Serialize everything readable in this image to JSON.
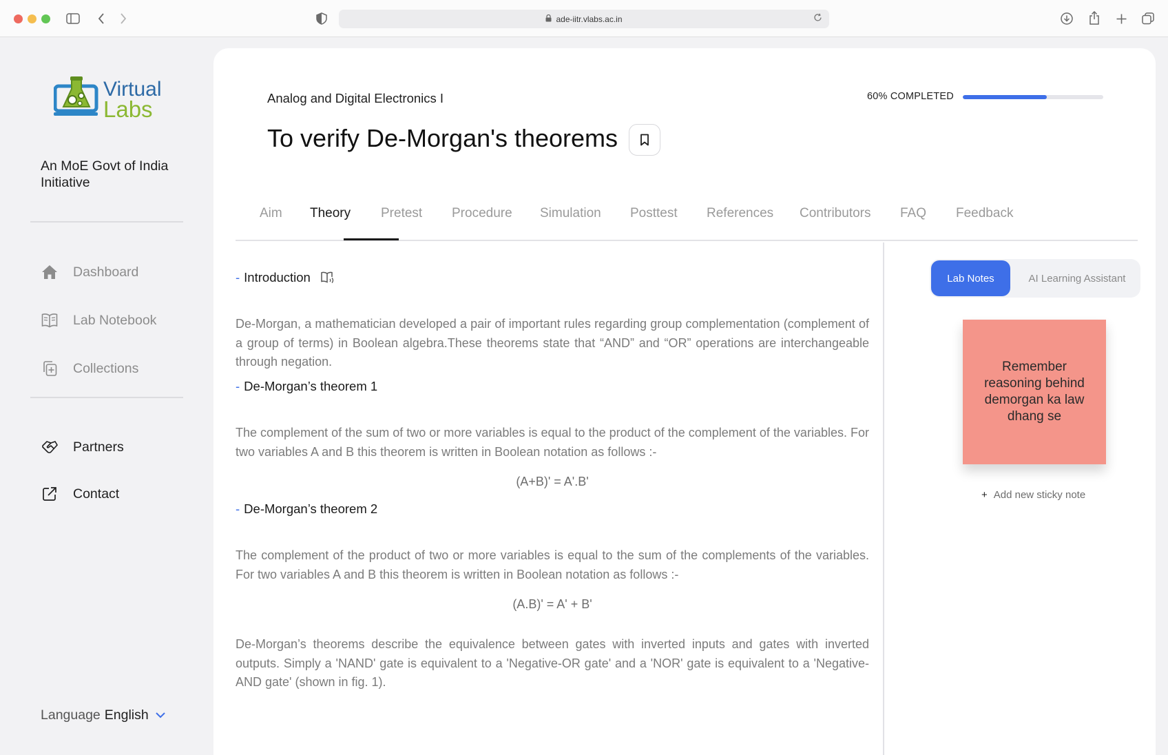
{
  "browser": {
    "url": "ade-iitr.vlabs.ac.in"
  },
  "sidebar": {
    "logo": {
      "line1": "Virtual",
      "line2": "Labs"
    },
    "tagline": "An MoE Govt of India Initiative",
    "nav": [
      {
        "label": "Dashboard",
        "icon": "home-icon"
      },
      {
        "label": "Lab Notebook",
        "icon": "notebook-icon"
      },
      {
        "label": "Collections",
        "icon": "collections-icon"
      }
    ],
    "links": [
      {
        "label": "Partners",
        "icon": "handshake-icon"
      },
      {
        "label": "Contact",
        "icon": "external-link-icon"
      }
    ],
    "language": {
      "label": "Language",
      "value": "English"
    }
  },
  "header": {
    "course": "Analog and Digital Electronics I",
    "title": "To verify De-Morgan's theorems",
    "progress_label": "60% COMPLETED",
    "progress_fraction": 0.6
  },
  "tabs": [
    "Aim",
    "Theory",
    "Pretest",
    "Procedure",
    "Simulation",
    "Posttest",
    "References",
    "Contributors",
    "FAQ",
    "Feedback"
  ],
  "active_tab": "Theory",
  "theory": {
    "intro_heading": "Introduction",
    "intro_text": "De-Morgan, a mathematician developed a pair of important rules regarding group complementation (complement of a group of terms) in Boolean algebra.These theorems state that “AND” and “OR” operations are interchangeable through negation.",
    "t1_heading": "De-Morgan’s theorem 1",
    "t1_text": "The complement of the sum of two or more variables is equal to the product of the complement of the variables. For two variables A and B this theorem is written in Boolean notation as follows :-",
    "t1_formula": "(A+B)' = A'.B'",
    "t2_heading": "De-Morgan’s theorem 2",
    "t2_text": "The complement of the product of two or more variables is equal to the sum of the complements of the variables. For two variables A and B this theorem is written in Boolean notation as follows :-",
    "t2_formula": "(A.B)' = A' + B'",
    "closing_text": "De-Morgan’s theorems describe the equivalence between gates with inverted inputs and gates with inverted outputs. Simply a 'NAND' gate is equivalent to a 'Negative-OR gate' and a 'NOR' gate is equivalent to a 'Negative-AND gate' (shown in fig. 1)."
  },
  "notes_panel": {
    "tab_notes": "Lab Notes",
    "tab_assistant": "AI Learning Assistant",
    "sticky_text": "Remember reasoning behind demorgan ka law dhang se",
    "sticky_color": "#f4958a",
    "add_label": "Add new sticky note"
  },
  "colors": {
    "accent": "#3e6fe8"
  }
}
